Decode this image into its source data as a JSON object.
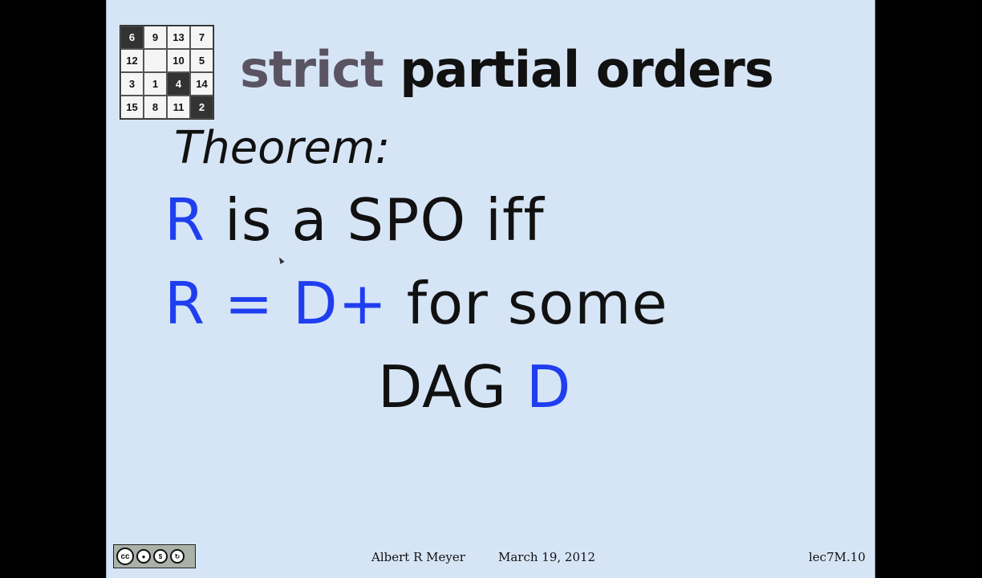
{
  "puzzle": {
    "tiles": [
      {
        "label": "6",
        "dark": true
      },
      {
        "label": "9",
        "dark": false
      },
      {
        "label": "13",
        "dark": false
      },
      {
        "label": "7",
        "dark": false
      },
      {
        "label": "12",
        "dark": false
      },
      {
        "label": "",
        "dark": false
      },
      {
        "label": "10",
        "dark": false
      },
      {
        "label": "5",
        "dark": false
      },
      {
        "label": "3",
        "dark": false
      },
      {
        "label": "1",
        "dark": false
      },
      {
        "label": "4",
        "dark": true
      },
      {
        "label": "14",
        "dark": false
      },
      {
        "label": "15",
        "dark": false
      },
      {
        "label": "8",
        "dark": false
      },
      {
        "label": "11",
        "dark": false
      },
      {
        "label": "2",
        "dark": true
      }
    ]
  },
  "title": {
    "highlight": "strict",
    "rest": " partial orders"
  },
  "theorem_label": "Theorem:",
  "statement": {
    "line1": {
      "R": "R",
      "rest": " is a SPO iff"
    },
    "line2": {
      "R": "R",
      "eq": " = ",
      "Dplus": "D+",
      "rest": " for some"
    },
    "line3": {
      "dag": "DAG ",
      "D": "D"
    }
  },
  "footer": {
    "author": "Albert R Meyer",
    "date": "March 19, 2012",
    "slide_number": "lec7M.10"
  },
  "license": {
    "cc": "cc",
    "icons": [
      "by-icon",
      "nc-icon",
      "sa-icon"
    ]
  },
  "colors": {
    "background": "#d6e5f6",
    "blue": "#1f3ef0",
    "title_highlight": "#5a5462"
  }
}
